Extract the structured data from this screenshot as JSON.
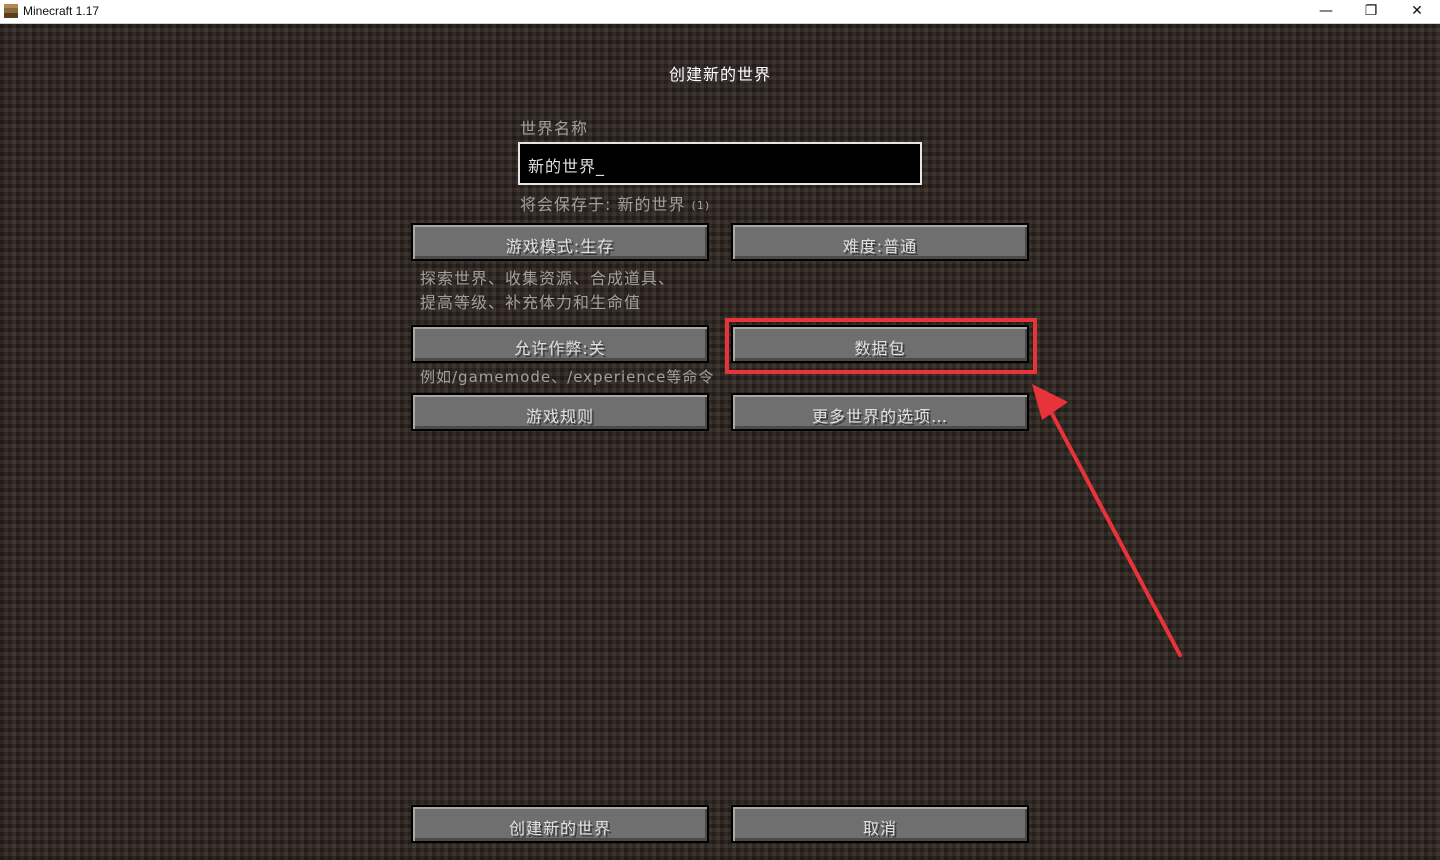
{
  "window": {
    "title": "Minecraft 1.17",
    "minimize": "—",
    "maximize": "❐",
    "close": "✕"
  },
  "screen": {
    "title": "创建新的世界",
    "world_name_label": "世界名称",
    "world_name_value": "新的世界_",
    "save_hint": "将会保存于: 新的世界",
    "save_hint_suffix": "(1)"
  },
  "buttons": {
    "game_mode": "游戏模式:生存",
    "difficulty": "难度:普通",
    "allow_cheats": "允许作弊:关",
    "data_packs": "数据包",
    "game_rules": "游戏规则",
    "more_world_options": "更多世界的选项…",
    "create": "创建新的世界",
    "cancel": "取消"
  },
  "descriptions": {
    "game_mode_line1": "探索世界、收集资源、合成道具、",
    "game_mode_line2": "提高等级、补充体力和生命值",
    "cheats_hint": "例如/gamemode、/experience等命令"
  },
  "annotation": {
    "color": "#e8333a",
    "target": "data_packs"
  }
}
